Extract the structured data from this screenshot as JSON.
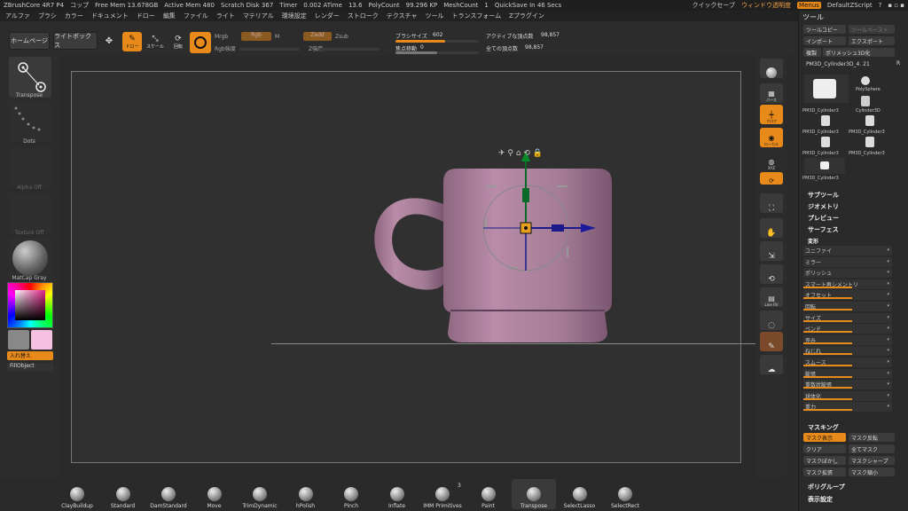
{
  "menubar": {
    "items": [
      "ZBrushCore 4R7 P4",
      "コップ",
      "Free Mem 13.678GB",
      "Active Mem 480",
      "Scratch Disk 367",
      "Timer",
      "0.002 ATime",
      "13.6",
      "PolyCount",
      "99.296 KP",
      "MeshCount",
      "1",
      "QuickSave In 46 Secs"
    ],
    "quick_save": "クイックセーブ",
    "window_transparency": "ウィンドウ透明度",
    "menus": "Menus",
    "default_script": "DefaultZScript"
  },
  "menus": [
    "アルファ",
    "ブラシ",
    "カラー",
    "ドキュメント",
    "ドロー",
    "編集",
    "ファイル",
    "ライト",
    "マテリアル",
    "環境設定",
    "レンダー",
    "ストローク",
    "テクスチャ",
    "ツール",
    "トランスフォーム",
    "Zプラグイン"
  ],
  "topbar": {
    "home": "ホームページ",
    "lightbox": "ライトボックス",
    "tool_icons": [
      "移動",
      "ドロー",
      "スケール",
      "回転",
      "Rot"
    ],
    "mrgb": "Mrgb",
    "rgb": "Rgb",
    "m": "M",
    "zadd": "Zadd",
    "zsub": "Zsub",
    "rgb_intensity": "Rgb強度",
    "z_intensity": "Z強度",
    "brush_size_label": "ブラシサイズ",
    "brush_size": "602",
    "focal_shift_label": "焦点移動",
    "focal_shift": "0",
    "active_points_label": "アクティブな頂点数",
    "active_points": "98,857",
    "total_points_label": "全ての頂点数",
    "total_points": "98,857",
    "brush_size_fraction": 0.6,
    "focal_shift_fraction": 0.5
  },
  "left": {
    "transpose": "Transpose",
    "dots": "Dots",
    "alpha": "Alpha Off",
    "texture": "Texture Off",
    "matcap": "MatCap Gray",
    "swap": "入れ替え",
    "fill": "FillObject"
  },
  "rightstrip": {
    "items": [
      "",
      "パース",
      "フロア",
      "ローカル",
      "XYZ",
      "",
      "",
      "",
      "",
      "",
      "Line Fill",
      "透明",
      "",
      "ソロ"
    ]
  },
  "toolpanel": {
    "title": "ツール",
    "load": "ツールコピー",
    "paste": "ツールペースト",
    "import": "インポート",
    "export": "エクスポート",
    "clone": "複製",
    "polymesh": "ポリメッシュ3D化",
    "current_tool": "PM3D_Cylinder3D_4. 21",
    "r": "R",
    "thumbs": [
      "PM3D_Cylinder3",
      "PolySphere",
      "Cylinder3D",
      "PM3D_Cylinder3",
      "PM3D_Cylinder3",
      "PM3D_Cylinder3",
      "PM3D_Cylinder3",
      "PM3D_Cylinder3"
    ],
    "sections": [
      "サブツール",
      "ジオメトリ",
      "プレビュー",
      "サーフェス",
      "変形"
    ],
    "deform": [
      "ユニファイ",
      "ミラー",
      "ポリッシュ",
      "スマート再シメントリ",
      "オフセット",
      "回転",
      "サイズ",
      "ベンド",
      "歪み",
      "ねじれ",
      "スムース",
      "膨張",
      "重数状膨張",
      "球体化",
      "重力"
    ],
    "masking_title": "マスキング",
    "mask_buttons": [
      "マスク表示",
      "マスク反転",
      "クリア",
      "全てマスク",
      "マスクぼかし",
      "マスクシャープ",
      "マスク拡張",
      "マスク縮小"
    ],
    "polygroup": "ポリグループ",
    "display": "表示設定"
  },
  "brushes": [
    "ClayBuildup",
    "Standard",
    "DamStandard",
    "Move",
    "TrimDynamic",
    "hPolish",
    "Pinch",
    "Inflate",
    "IMM Primitives",
    "Paint",
    "Transpose",
    "SelectLasso",
    "SelectRect"
  ],
  "imm_count": "3",
  "colors": {
    "accent": "#e88a1a",
    "mug": "#b888a4",
    "bg": "#2a2a2a",
    "canvas": "#303030"
  }
}
